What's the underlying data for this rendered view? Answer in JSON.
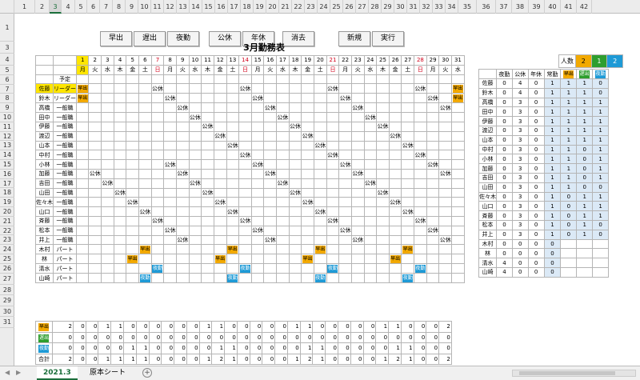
{
  "columns": [
    "1",
    "2",
    "3",
    "4",
    "5",
    "6",
    "7",
    "8",
    "9",
    "10",
    "11",
    "12",
    "13",
    "14",
    "15",
    "16",
    "17",
    "18",
    "19",
    "20",
    "21",
    "22",
    "23",
    "24",
    "25",
    "26",
    "27",
    "28",
    "29",
    "30",
    "31",
    "32",
    "33",
    "34",
    "35",
    "36",
    "37",
    "38",
    "39",
    "40",
    "41",
    "42"
  ],
  "rows": [
    "1",
    "2",
    "3",
    "4",
    "5",
    "6",
    "7",
    "8",
    "9",
    "10",
    "11",
    "12",
    "13",
    "14",
    "15",
    "16",
    "17",
    "18",
    "19",
    "20",
    "21",
    "22",
    "23",
    "24",
    "25",
    "26",
    "27",
    "28",
    "29",
    "30",
    "31"
  ],
  "buttons": [
    "早出",
    "遅出",
    "夜勤",
    "公休",
    "年休",
    "消去",
    "新規",
    "実行"
  ],
  "title": "3月勤務表",
  "days": [
    "1",
    "2",
    "3",
    "4",
    "5",
    "6",
    "7",
    "8",
    "9",
    "10",
    "11",
    "12",
    "13",
    "14",
    "15",
    "16",
    "17",
    "18",
    "19",
    "20",
    "21",
    "22",
    "23",
    "24",
    "25",
    "26",
    "27",
    "28",
    "29",
    "30",
    "31"
  ],
  "weekdays": [
    "月",
    "火",
    "水",
    "木",
    "金",
    "土",
    "日",
    "月",
    "火",
    "水",
    "木",
    "金",
    "土",
    "日",
    "月",
    "火",
    "水",
    "木",
    "金",
    "土",
    "日",
    "月",
    "火",
    "水",
    "木",
    "金",
    "土",
    "日",
    "月",
    "火",
    "水"
  ],
  "sunday_color": "#d0021b",
  "yotei_label": "予定",
  "staff": [
    {
      "name": "佐藤",
      "role": "リーダー"
    },
    {
      "name": "鈴木",
      "role": "リーダー"
    },
    {
      "name": "高橋",
      "role": "一般職"
    },
    {
      "name": "田中",
      "role": "一般職"
    },
    {
      "name": "伊藤",
      "role": "一般職"
    },
    {
      "name": "渡辺",
      "role": "一般職"
    },
    {
      "name": "山本",
      "role": "一般職"
    },
    {
      "name": "中村",
      "role": "一般職"
    },
    {
      "name": "小林",
      "role": "一般職"
    },
    {
      "name": "加藤",
      "role": "一般職"
    },
    {
      "name": "吉田",
      "role": "一般職"
    },
    {
      "name": "山田",
      "role": "一般職"
    },
    {
      "name": "佐々木",
      "role": "一般職"
    },
    {
      "name": "山口",
      "role": "一般職"
    },
    {
      "name": "斉藤",
      "role": "一般職"
    },
    {
      "name": "松本",
      "role": "一般職"
    },
    {
      "name": "井上",
      "role": "一般職"
    },
    {
      "name": "木村",
      "role": "パート"
    },
    {
      "name": "林",
      "role": "パート"
    },
    {
      "name": "清水",
      "role": "パート"
    },
    {
      "name": "山崎",
      "role": "パート"
    }
  ],
  "shift_labels": {
    "E": "早出",
    "L": "遅出",
    "N": "夜勤",
    "K": "公休"
  },
  "schedule": [
    {
      "1": "E",
      "7": "K",
      "14": "K",
      "21": "K",
      "28": "K",
      "31": "E"
    },
    {
      "1": "E",
      "8": "K",
      "15": "K",
      "22": "K",
      "29": "K",
      "31": "E"
    },
    {
      "9": "K",
      "16": "K",
      "23": "K",
      "30": "K"
    },
    {
      "10": "K",
      "17": "K",
      "24": "K"
    },
    {
      "11": "K",
      "18": "K",
      "25": "K"
    },
    {
      "12": "K",
      "19": "K",
      "26": "K"
    },
    {
      "13": "K",
      "20": "K",
      "27": "K"
    },
    {
      "14": "K",
      "21": "K",
      "28": "K"
    },
    {
      "8": "K",
      "15": "K",
      "22": "K",
      "29": "K"
    },
    {
      "2": "K",
      "9": "K",
      "16": "K",
      "23": "K",
      "30": "K"
    },
    {
      "3": "K",
      "10": "K",
      "17": "K",
      "24": "K"
    },
    {
      "4": "K",
      "11": "K",
      "18": "K",
      "25": "K"
    },
    {
      "5": "K",
      "12": "K",
      "19": "K",
      "26": "K"
    },
    {
      "6": "K",
      "13": "K",
      "20": "K",
      "27": "K"
    },
    {
      "7": "K",
      "14": "K",
      "21": "K",
      "28": "K"
    },
    {
      "8": "K",
      "15": "K",
      "22": "K",
      "29": "K"
    },
    {
      "9": "K",
      "16": "K",
      "23": "K",
      "30": "K"
    },
    {
      "6": "E",
      "13": "E",
      "20": "E",
      "27": "E"
    },
    {
      "5": "E",
      "12": "E",
      "19": "E",
      "26": "E"
    },
    {
      "7": "N",
      "14": "N",
      "21": "N",
      "28": "N"
    },
    {
      "6": "N",
      "13": "N",
      "20": "N",
      "27": "N"
    }
  ],
  "tally_rows": [
    {
      "key": "E",
      "label": "早出",
      "values": [
        "2",
        "0",
        "0",
        "1",
        "1",
        "0",
        "0",
        "0",
        "0",
        "0",
        "0",
        "1",
        "1",
        "0",
        "0",
        "0",
        "0",
        "0",
        "1",
        "1",
        "0",
        "0",
        "0",
        "0",
        "0",
        "1",
        "1",
        "0",
        "0",
        "0",
        "2"
      ]
    },
    {
      "key": "L",
      "label": "遅出",
      "values": [
        "0",
        "0",
        "0",
        "0",
        "0",
        "0",
        "0",
        "0",
        "0",
        "0",
        "0",
        "0",
        "0",
        "0",
        "0",
        "0",
        "0",
        "0",
        "0",
        "0",
        "0",
        "0",
        "0",
        "0",
        "0",
        "0",
        "0",
        "0",
        "0",
        "0",
        "0"
      ]
    },
    {
      "key": "N",
      "label": "夜勤",
      "values": [
        "0",
        "0",
        "0",
        "0",
        "0",
        "1",
        "1",
        "0",
        "0",
        "0",
        "0",
        "0",
        "1",
        "1",
        "0",
        "0",
        "0",
        "0",
        "0",
        "1",
        "1",
        "0",
        "0",
        "0",
        "0",
        "0",
        "1",
        "1",
        "0",
        "0",
        "0"
      ]
    },
    {
      "key": "T",
      "label": "合計",
      "values": [
        "2",
        "0",
        "0",
        "1",
        "1",
        "1",
        "1",
        "0",
        "0",
        "0",
        "0",
        "1",
        "2",
        "1",
        "0",
        "0",
        "0",
        "0",
        "1",
        "2",
        "1",
        "0",
        "0",
        "0",
        "0",
        "1",
        "2",
        "1",
        "0",
        "0",
        "2"
      ]
    }
  ],
  "summary": {
    "required_label": "人数",
    "required": [
      "2",
      "1",
      "2"
    ],
    "headers": [
      "夜勤",
      "公休",
      "年休",
      "常勤",
      "早出",
      "遅出",
      "夜勤"
    ],
    "rows": [
      [
        "0",
        "4",
        "0",
        "1",
        "1",
        "1",
        "0"
      ],
      [
        "0",
        "4",
        "0",
        "1",
        "1",
        "1",
        "0"
      ],
      [
        "0",
        "3",
        "0",
        "1",
        "1",
        "1",
        "1"
      ],
      [
        "0",
        "3",
        "0",
        "1",
        "1",
        "1",
        "1"
      ],
      [
        "0",
        "3",
        "0",
        "1",
        "1",
        "1",
        "1"
      ],
      [
        "0",
        "3",
        "0",
        "1",
        "1",
        "1",
        "1"
      ],
      [
        "0",
        "3",
        "0",
        "1",
        "1",
        "1",
        "1"
      ],
      [
        "0",
        "3",
        "0",
        "1",
        "1",
        "0",
        "1"
      ],
      [
        "0",
        "3",
        "0",
        "1",
        "1",
        "0",
        "1"
      ],
      [
        "0",
        "3",
        "0",
        "1",
        "1",
        "0",
        "1"
      ],
      [
        "0",
        "3",
        "0",
        "1",
        "1",
        "0",
        "1"
      ],
      [
        "0",
        "3",
        "0",
        "1",
        "1",
        "0",
        "0"
      ],
      [
        "0",
        "3",
        "0",
        "1",
        "0",
        "1",
        "1"
      ],
      [
        "0",
        "3",
        "0",
        "1",
        "0",
        "1",
        "1"
      ],
      [
        "0",
        "3",
        "0",
        "1",
        "0",
        "1",
        "1"
      ],
      [
        "0",
        "3",
        "0",
        "1",
        "0",
        "1",
        "0"
      ],
      [
        "0",
        "3",
        "0",
        "1",
        "0",
        "1",
        "0"
      ],
      [
        "0",
        "0",
        "0",
        "0",
        "",
        "",
        ""
      ],
      [
        "0",
        "0",
        "0",
        "0",
        "",
        "",
        ""
      ],
      [
        "4",
        "0",
        "0",
        "0",
        "",
        "",
        ""
      ],
      [
        "4",
        "0",
        "0",
        "0",
        "",
        "",
        ""
      ]
    ]
  },
  "tabs": [
    "2021.3",
    "原本シート"
  ],
  "add_sheet": "+",
  "colors": {
    "early": "#f2a900",
    "late": "#2e9e2e",
    "night": "#1e9ad6",
    "highlight": "#ffe600"
  }
}
